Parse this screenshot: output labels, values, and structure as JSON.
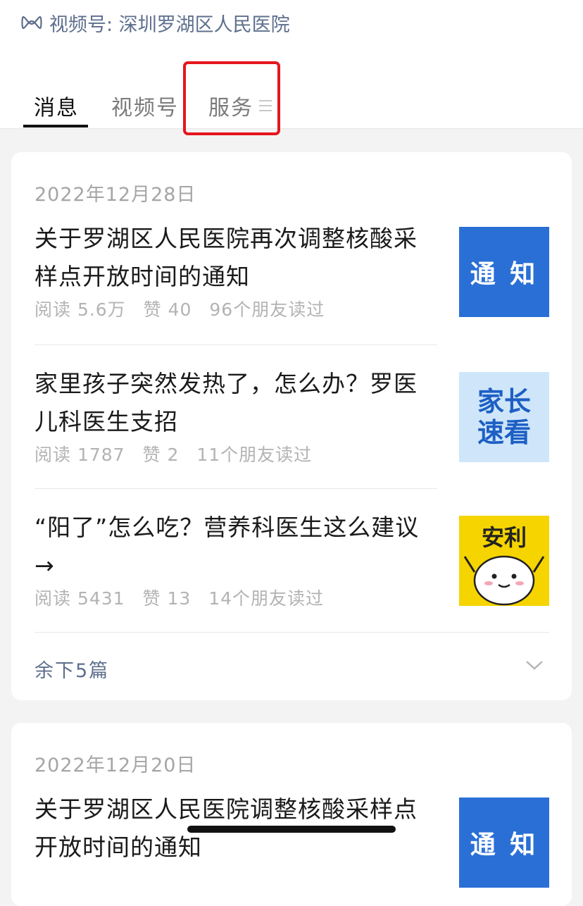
{
  "header": {
    "channel_label": "视频号: 深圳罗湖区人民医院"
  },
  "tabs": [
    {
      "label": "消息",
      "active": true
    },
    {
      "label": "视频号",
      "active": false
    },
    {
      "label": "服务",
      "active": false
    }
  ],
  "colors": {
    "accent_red": "#e5161d",
    "link_blue": "#5e6f8d",
    "thumb_blue": "#2a6fd6",
    "thumb_yellow": "#f5d400"
  },
  "groups": [
    {
      "date": "2022年12月28日",
      "articles": [
        {
          "title": "关于罗湖区人民医院再次调整核酸采样点开放时间的通知",
          "read": "阅读 5.6万",
          "likes": "赞 40",
          "friends": "96个朋友读过",
          "thumb_text": "通 知"
        },
        {
          "title": "家里孩子突然发热了，怎么办？罗医儿科医生支招",
          "read": "阅读 1787",
          "likes": "赞 2",
          "friends": "11个朋友读过",
          "thumb_text_1": "家长",
          "thumb_text_2": "速看"
        },
        {
          "title": "“阳了”怎么吃？营养科医生这么建议→",
          "read": "阅读 5431",
          "likes": "赞 13",
          "friends": "14个朋友读过",
          "thumb_text": "安利"
        }
      ],
      "more_label": "余下5篇"
    },
    {
      "date": "2022年12月20日",
      "articles": [
        {
          "title": "关于罗湖区人民医院调整核酸采样点开放时间的通知",
          "thumb_text": "通 知"
        }
      ]
    }
  ]
}
